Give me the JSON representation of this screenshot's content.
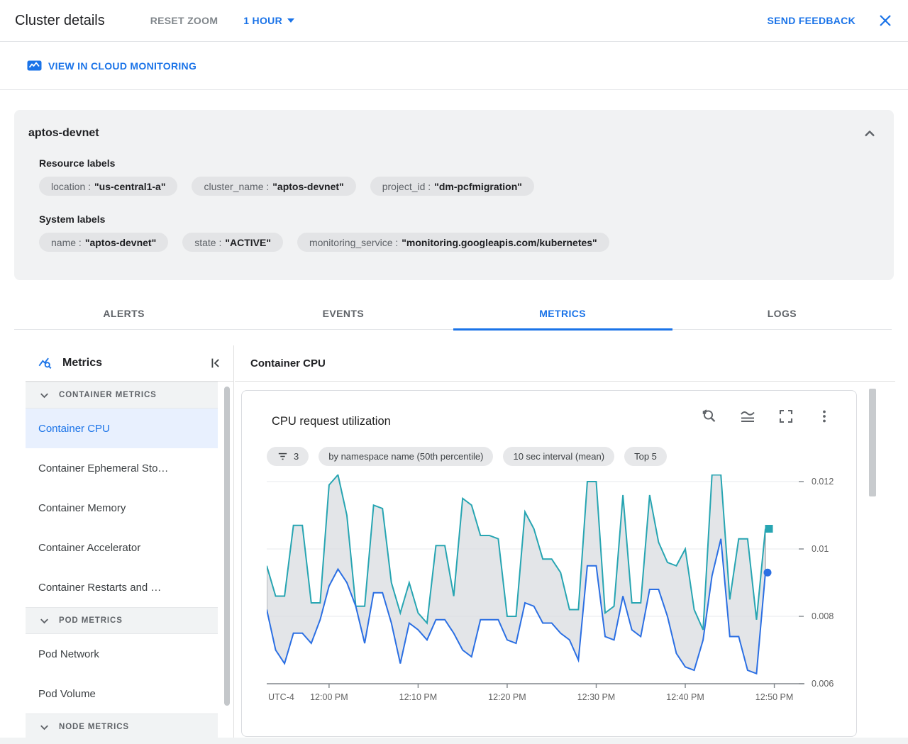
{
  "header": {
    "title": "Cluster details",
    "reset_zoom_label": "RESET ZOOM",
    "time_range_label": "1 HOUR",
    "send_feedback_label": "SEND FEEDBACK"
  },
  "monitoring_link_label": "VIEW IN CLOUD MONITORING",
  "cluster": {
    "name": "aptos-devnet",
    "resource_labels_title": "Resource labels",
    "resource_labels": [
      {
        "key": "location",
        "value": "\"us-central1-a\""
      },
      {
        "key": "cluster_name",
        "value": "\"aptos-devnet\""
      },
      {
        "key": "project_id",
        "value": "\"dm-pcfmigration\""
      }
    ],
    "system_labels_title": "System labels",
    "system_labels": [
      {
        "key": "name",
        "value": "\"aptos-devnet\""
      },
      {
        "key": "state",
        "value": "\"ACTIVE\""
      },
      {
        "key": "monitoring_service",
        "value": "\"monitoring.googleapis.com/kubernetes\""
      }
    ]
  },
  "tabs": [
    {
      "label": "ALERTS",
      "active": false
    },
    {
      "label": "EVENTS",
      "active": false
    },
    {
      "label": "METRICS",
      "active": true
    },
    {
      "label": "LOGS",
      "active": false
    }
  ],
  "sidebar": {
    "title": "Metrics",
    "sections": [
      {
        "header": "CONTAINER METRICS",
        "items": [
          {
            "label": "Container CPU",
            "selected": true
          },
          {
            "label": "Container Ephemeral Sto…",
            "selected": false
          },
          {
            "label": "Container Memory",
            "selected": false
          },
          {
            "label": "Container Accelerator",
            "selected": false
          },
          {
            "label": "Container Restarts and …",
            "selected": false
          }
        ]
      },
      {
        "header": "POD METRICS",
        "items": [
          {
            "label": "Pod Network",
            "selected": false
          },
          {
            "label": "Pod Volume",
            "selected": false
          }
        ]
      },
      {
        "header": "NODE METRICS",
        "items": []
      }
    ]
  },
  "main": {
    "panel_title": "Container CPU"
  },
  "chart_data": {
    "type": "line",
    "title": "CPU request utilization",
    "chips": [
      {
        "icon": "filter-icon",
        "label": "3"
      },
      {
        "label": "by namespace name (50th percentile)"
      },
      {
        "label": "10 sec interval (mean)"
      },
      {
        "label": "Top 5"
      }
    ],
    "ylim": [
      0.006,
      0.0125
    ],
    "y_ticks": [
      {
        "label": "0.012",
        "value": 0.012
      },
      {
        "label": "0.01",
        "value": 0.01
      },
      {
        "label": "0.008",
        "value": 0.008
      },
      {
        "label": "0.006",
        "value": 0.006
      }
    ],
    "x_axis_zone_label": "UTC-4",
    "x_ticks": [
      {
        "label": "12:00 PM",
        "minute": 7
      },
      {
        "label": "12:10 PM",
        "minute": 17
      },
      {
        "label": "12:20 PM",
        "minute": 27
      },
      {
        "label": "12:30 PM",
        "minute": 37
      },
      {
        "label": "12:40 PM",
        "minute": 47
      },
      {
        "label": "12:50 PM",
        "minute": 57
      }
    ],
    "band_between_series": true,
    "band_fill": "#dadce0",
    "band_stroke": "#8f9397",
    "grid_color": "#e7e9ec",
    "axis_color": "#80868b",
    "series": [
      {
        "name": "upper (teal)",
        "color": "#27a5b2",
        "marker": "square",
        "values": [
          0.0095,
          0.0086,
          0.0086,
          0.0107,
          0.0107,
          0.0084,
          0.0084,
          0.0119,
          0.0122,
          0.011,
          0.0083,
          0.0083,
          0.0113,
          0.0112,
          0.009,
          0.0081,
          0.009,
          0.0081,
          0.0078,
          0.0101,
          0.0101,
          0.0086,
          0.0115,
          0.0113,
          0.0104,
          0.0104,
          0.0103,
          0.008,
          0.008,
          0.0111,
          0.0106,
          0.0097,
          0.0097,
          0.0093,
          0.0082,
          0.0082,
          0.012,
          0.012,
          0.0081,
          0.0083,
          0.0116,
          0.0084,
          0.0084,
          0.0116,
          0.0102,
          0.0096,
          0.0095,
          0.01,
          0.0082,
          0.0076,
          0.0122,
          0.0122,
          0.0085,
          0.0103,
          0.0103,
          0.0079,
          0.0106
        ]
      },
      {
        "name": "lower (blue)",
        "color": "#2b6fe3",
        "marker": "circle",
        "values": [
          0.0082,
          0.007,
          0.0066,
          0.0075,
          0.0075,
          0.0072,
          0.0079,
          0.0089,
          0.0094,
          0.009,
          0.0083,
          0.0072,
          0.0087,
          0.0087,
          0.0078,
          0.0066,
          0.0078,
          0.0076,
          0.0073,
          0.0079,
          0.0079,
          0.0075,
          0.007,
          0.0068,
          0.0079,
          0.0079,
          0.0079,
          0.0073,
          0.0072,
          0.0084,
          0.0083,
          0.0078,
          0.0078,
          0.0075,
          0.0073,
          0.0067,
          0.0095,
          0.0095,
          0.0074,
          0.0073,
          0.0086,
          0.0076,
          0.0074,
          0.0088,
          0.0088,
          0.008,
          0.0069,
          0.0065,
          0.0064,
          0.0073,
          0.0092,
          0.0103,
          0.0074,
          0.0074,
          0.0064,
          0.0063,
          0.0093
        ]
      }
    ]
  }
}
